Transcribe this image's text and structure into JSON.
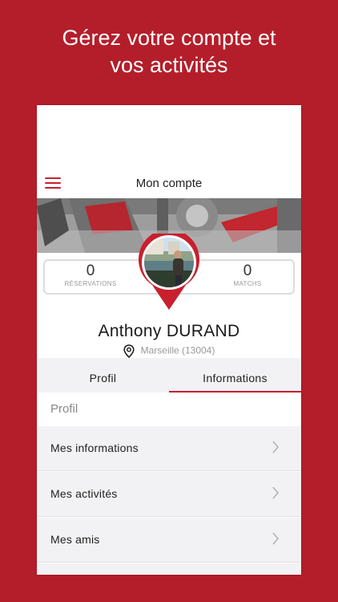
{
  "headline": {
    "line1": "Gérez votre compte et",
    "line2": "vos activités"
  },
  "app": {
    "title": "Mon compte"
  },
  "stats": [
    {
      "value": "0",
      "label": "RÉSERVATIONS"
    },
    {
      "value": "0",
      "label": "MATCHS"
    }
  ],
  "profile": {
    "first_name": "Anthony",
    "last_name": "DURAND",
    "location": "Marseille (13004)"
  },
  "tabs": [
    {
      "label": "Profil",
      "active": false
    },
    {
      "label": "Informations",
      "active": true
    }
  ],
  "section": {
    "header": "Profil"
  },
  "menu": [
    {
      "label": "Mes informations"
    },
    {
      "label": "Mes activités"
    },
    {
      "label": "Mes amis"
    }
  ],
  "colors": {
    "brand": "#b41e2a",
    "accent": "#c8202e"
  },
  "icons": [
    "menu-icon",
    "location-pin-icon",
    "chevron-right-icon"
  ]
}
